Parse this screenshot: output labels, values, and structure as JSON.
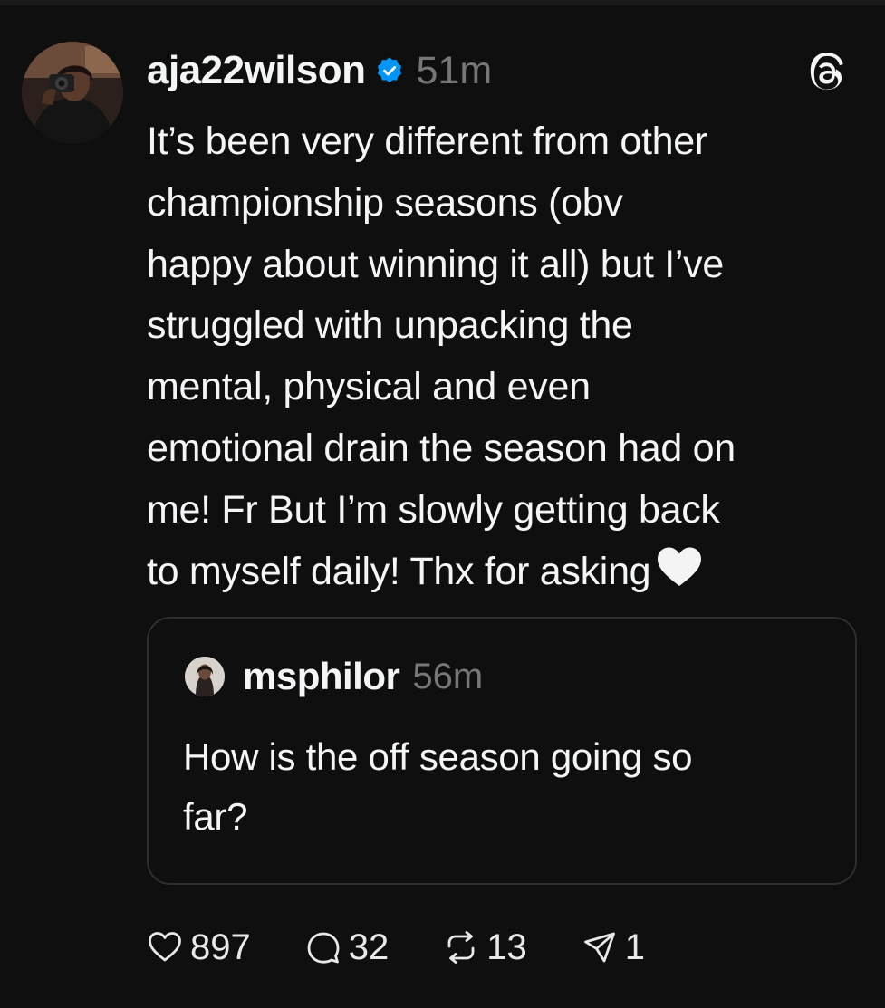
{
  "post": {
    "author": "aja22wilson",
    "time": "51m",
    "text": "It’s been very different from other\nchampionship seasons (obv\nhappy about winning it all) but I’ve\nstruggled with unpacking the\nmental, physical and even\nemotional drain the season had on\nme! Fr But I’m slowly getting back\nto myself daily! Thx for asking",
    "emoji": "white-heart"
  },
  "quote": {
    "author": "msphilor",
    "time": "56m",
    "text": "How is the off season going so\nfar?"
  },
  "actions": {
    "likes": "897",
    "replies": "32",
    "reposts": "13",
    "shares": "1"
  },
  "colors": {
    "background": "#0f0f0f",
    "text": "#f3f5f7",
    "muted": "#777777",
    "verified": "#0095f6",
    "border": "#2e2e2e"
  },
  "icons": [
    "threads-logo-icon",
    "verified-badge-icon",
    "heart-icon",
    "comment-icon",
    "repost-icon",
    "share-icon"
  ]
}
